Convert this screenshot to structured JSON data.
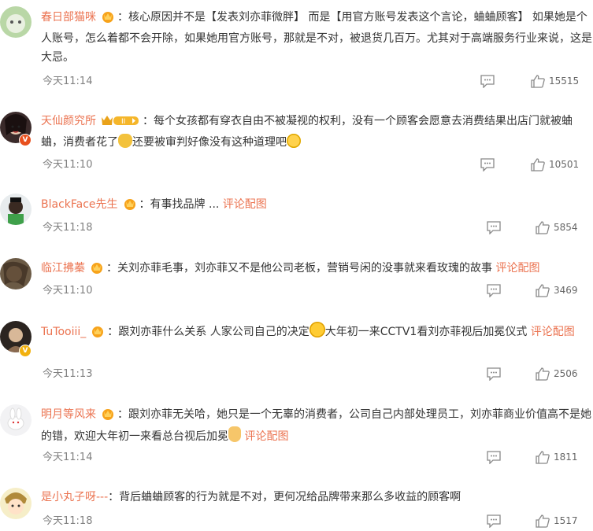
{
  "comments": [
    {
      "user": "春日部猫咪",
      "sep": "：",
      "text": "核心原因并不是【发表刘亦菲微胖】 而是【用官方账号发表这个言论，蛐蛐顾客】 如果她是个人账号，怎么着都不会开除，如果她用官方账号，那就是不对，被退货几百万。尤其对于高端服务行业来说，这是大忌。",
      "time": "今天11:14",
      "likes": "15515"
    },
    {
      "user": "天仙颜究所",
      "sep": "：",
      "text1": "每个女孩都有穿衣自由不被凝视的权利，没有一个顾客会愿意去消费结果出店门就被蛐蛐，消费者花了",
      "text2": "还要被审判好像没有这种道理吧",
      "time": "今天11:10",
      "likes": "10501"
    },
    {
      "user": "BlackFace先生",
      "sep": "：",
      "text": "有事找品牌 ... ",
      "link": "评论配图",
      "time": "今天11:18",
      "likes": "5854"
    },
    {
      "user": "临江拂蓁",
      "sep": "：",
      "text": "关刘亦菲毛事，刘亦菲又不是他公司老板，营销号闲的没事就来看玫瑰的故事 ",
      "link": "评论配图",
      "time": "今天11:10",
      "likes": "3469"
    },
    {
      "user": "TuTooiii_",
      "sep": "：",
      "text1": "跟刘亦菲什么关系 人家公司自己的决定",
      "text2": "大年初一来CCTV1看刘亦菲视后加冕仪式 ",
      "link": "评论配图",
      "time": "今天11:13",
      "likes": "2506"
    },
    {
      "user": "明月等风来",
      "sep": "：",
      "text1": "跟刘亦菲无关哈，她只是一个无辜的消费者，公司自己内部处理员工，刘亦菲商业价值高不是她的错，欢迎大年初一来看总台视后加冕",
      "text2": " ",
      "link": "评论配图",
      "time": "今天11:14",
      "likes": "1811"
    },
    {
      "user": "是小丸子呀---",
      "sep": "：",
      "text": "背后蛐蛐顾客的行为就是不对，更何况给品牌带来那么多收益的顾客啊",
      "time": "今天11:18",
      "likes": "1517"
    }
  ]
}
